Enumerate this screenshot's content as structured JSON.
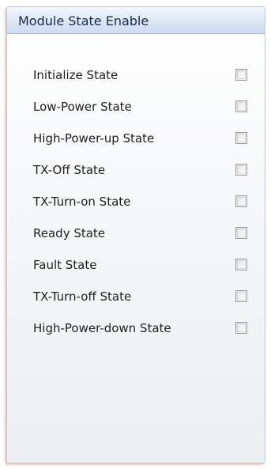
{
  "panel": {
    "title": "Module State Enable",
    "items": [
      {
        "label": "Initialize State",
        "checked": false
      },
      {
        "label": "Low-Power State",
        "checked": false
      },
      {
        "label": "High-Power-up State",
        "checked": false
      },
      {
        "label": "TX-Off State",
        "checked": false
      },
      {
        "label": "TX-Turn-on State",
        "checked": false
      },
      {
        "label": "Ready State",
        "checked": false
      },
      {
        "label": "Fault State",
        "checked": false
      },
      {
        "label": "TX-Turn-off State",
        "checked": false
      },
      {
        "label": "High-Power-down State",
        "checked": false
      }
    ]
  }
}
